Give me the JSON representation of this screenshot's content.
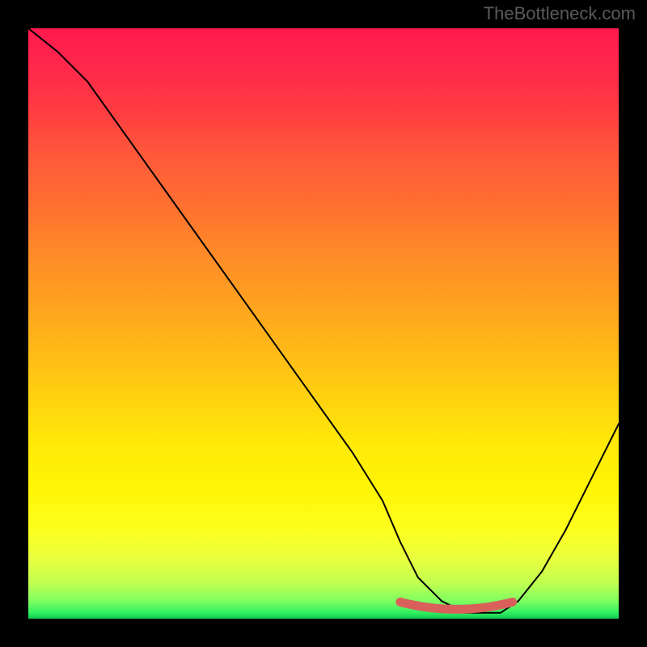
{
  "watermark": "TheBottleneck.com",
  "chart_data": {
    "type": "line",
    "title": "",
    "xlabel": "",
    "ylabel": "",
    "xlim": [
      0,
      100
    ],
    "ylim": [
      0,
      100
    ],
    "x": [
      0,
      5,
      10,
      15,
      20,
      25,
      30,
      35,
      40,
      45,
      50,
      55,
      60,
      63,
      66,
      70,
      74,
      77,
      80,
      83,
      87,
      91,
      95,
      100
    ],
    "values": [
      100,
      96,
      91,
      84,
      77,
      70,
      63,
      56,
      49,
      42,
      35,
      28,
      20,
      13,
      7,
      3,
      1,
      1,
      1,
      3,
      8,
      15,
      23,
      33
    ],
    "highlight_region": {
      "x_start": 63,
      "x_end": 82,
      "y": 2
    },
    "gradient_stops": [
      {
        "pos": 0,
        "color": "#ff1a4d"
      },
      {
        "pos": 50,
        "color": "#ffb000"
      },
      {
        "pos": 85,
        "color": "#fff000"
      },
      {
        "pos": 100,
        "color": "#10c850"
      }
    ]
  }
}
